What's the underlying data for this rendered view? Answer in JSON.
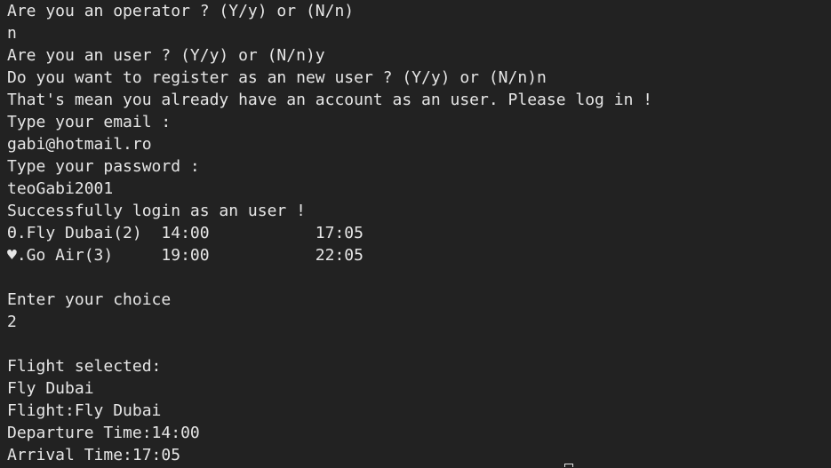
{
  "terminal": {
    "lines": [
      "Are you an operator ? (Y/y) or (N/n)",
      "n",
      "Are you an user ? (Y/y) or (N/n)y",
      "Do you want to register as an new user ? (Y/y) or (N/n)n",
      "That's mean you already have an account as an user. Please log in !",
      "Type your email :",
      "gabi@hotmail.ro",
      "Type your password :",
      "teoGabi2001",
      "Successfully login as an user !",
      "Θ.Fly Dubai(2)  14:00           17:05",
      "♥.Go Air(3)     19:00           22:05",
      "",
      "Enter your choice",
      "2",
      "",
      "Flight selected:",
      "Fly Dubai",
      "Flight:Fly Dubai",
      "Departure Time:14:00",
      "Arrival Time:17:05"
    ]
  },
  "colors": {
    "background": "#222222",
    "foreground": "#e6e6e6"
  }
}
